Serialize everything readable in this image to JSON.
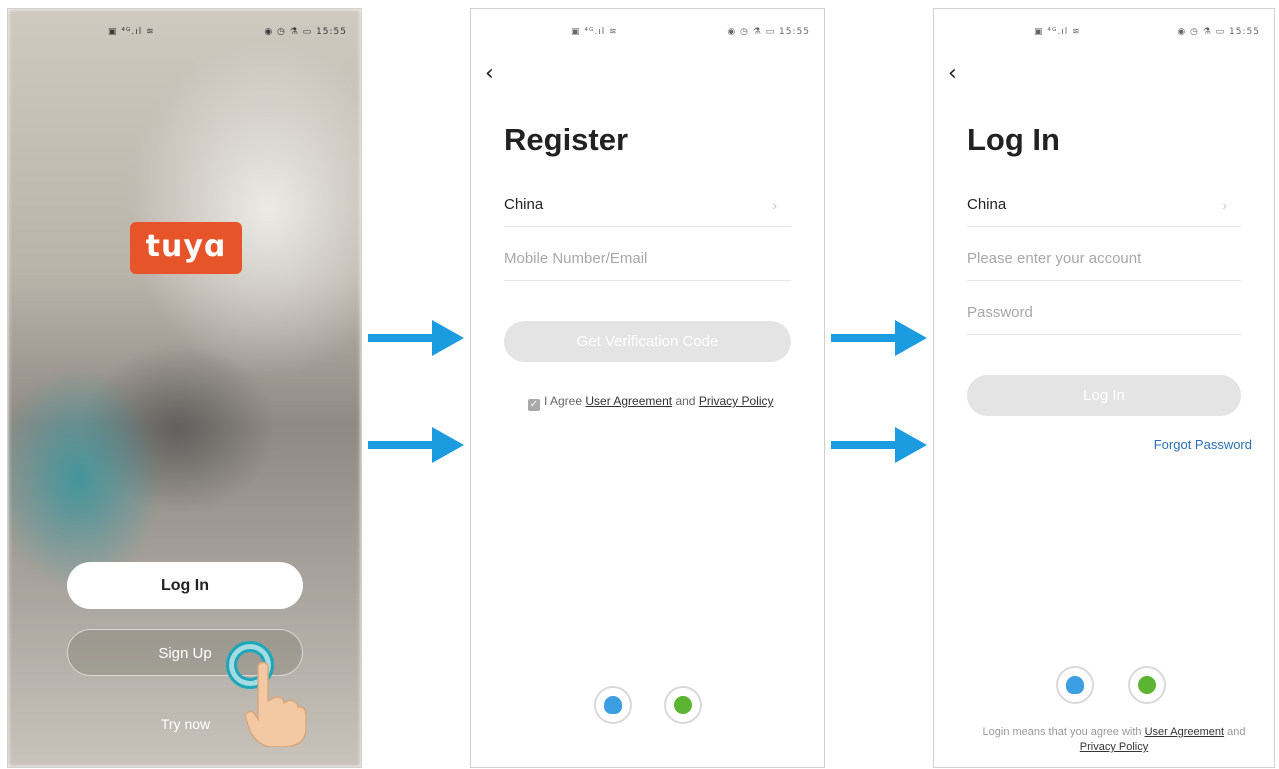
{
  "status_bar": {
    "left": "▣ ⁴ᴳ.ıl ≋",
    "right": "◉ ◷ ⚗ ▭ 15:55"
  },
  "screen1": {
    "logo": "tuyɑ",
    "login_label": "Log In",
    "signup_label": "Sign Up",
    "try_now_label": "Try now"
  },
  "screen2": {
    "back_icon": "‹",
    "title": "Register",
    "country": "China",
    "country_chevron": "›",
    "account_placeholder": "Mobile Number/Email",
    "button_label": "Get Verification Code",
    "agree_prefix": "I Agree",
    "user_agreement": "User Agreement",
    "agree_and": "and",
    "privacy_policy": "Privacy Policy"
  },
  "screen3": {
    "back_icon": "‹",
    "title": "Log In",
    "country": "China",
    "country_chevron": "›",
    "account_placeholder": "Please enter your account",
    "password_placeholder": "Password",
    "button_label": "Log In",
    "forgot_label": "Forgot Password",
    "terms_prefix": "Login means that you agree with",
    "terms_user_agreement": "User Agreement",
    "terms_and": "and",
    "terms_privacy": "Privacy Policy"
  },
  "colors": {
    "brand": "#e8542a",
    "arrow": "#1b9be0",
    "link": "#2c6fb3",
    "button_disabled": "#e4e4e4",
    "tap_highlight": "#1ea7b8"
  },
  "icons": [
    "back-arrow-icon",
    "chevron-right-icon",
    "checkbox-checked-icon",
    "qq-icon",
    "wechat-icon",
    "tap-gesture-icon",
    "flow-arrow-icon"
  ]
}
